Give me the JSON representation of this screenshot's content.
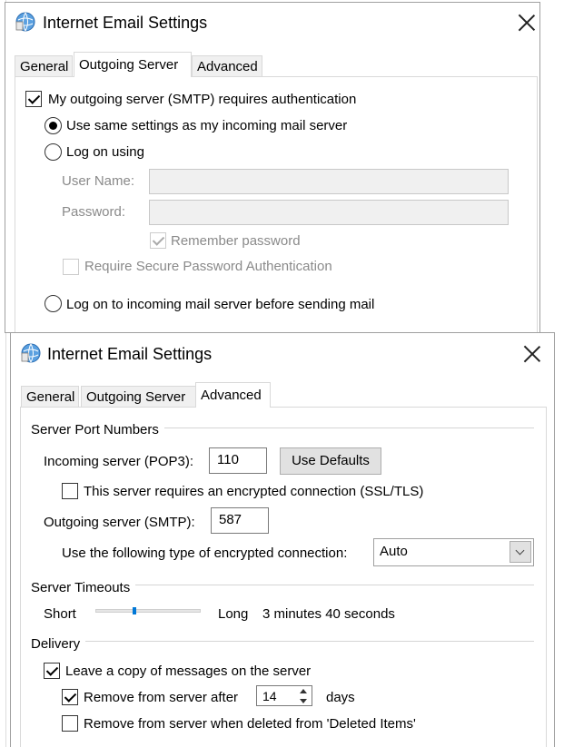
{
  "dialog1": {
    "title": "Internet Email Settings",
    "tabs": [
      {
        "label": "General",
        "active": false
      },
      {
        "label": "Outgoing Server",
        "active": true
      },
      {
        "label": "Advanced",
        "active": false
      }
    ],
    "smtp_auth": {
      "label": "My outgoing server (SMTP) requires authentication",
      "checked": true
    },
    "use_same": {
      "label": "Use same settings as my incoming mail server",
      "selected": true
    },
    "log_on_using": {
      "label": "Log on using",
      "selected": false
    },
    "user_name_label": "User Name:",
    "user_name_value": "",
    "password_label": "Password:",
    "password_value": "",
    "remember_password": {
      "label": "Remember password",
      "checked": true,
      "disabled": true
    },
    "require_spa": {
      "label": "Require Secure Password Authentication",
      "checked": false,
      "disabled": true
    },
    "log_on_incoming": {
      "label": "Log on to incoming mail server before sending mail",
      "selected": false
    }
  },
  "dialog2": {
    "title": "Internet Email Settings",
    "tabs": [
      {
        "label": "General",
        "active": false
      },
      {
        "label": "Outgoing Server",
        "active": false
      },
      {
        "label": "Advanced",
        "active": true
      }
    ],
    "server_port_numbers": "Server Port Numbers",
    "incoming_label": "Incoming server (POP3):",
    "incoming_value": "110",
    "use_defaults": "Use Defaults",
    "ssl_incoming": {
      "label": "This server requires an encrypted connection (SSL/TLS)",
      "checked": false
    },
    "outgoing_label": "Outgoing server (SMTP):",
    "outgoing_value": "587",
    "encryption_label": "Use the following type of encrypted connection:",
    "encryption_value": "Auto",
    "server_timeouts": "Server Timeouts",
    "short_label": "Short",
    "long_label": "Long",
    "timeout_value": "3 minutes 40 seconds",
    "timeout_level_fraction": 0.37,
    "delivery": "Delivery",
    "leave_copy": {
      "label": "Leave a copy of messages on the server",
      "checked": true
    },
    "remove_after": {
      "label": "Remove from server after",
      "checked": true
    },
    "remove_days_value": "14",
    "days_label": "days",
    "remove_deleted": {
      "label": "Remove from server when deleted from 'Deleted Items'",
      "checked": false
    }
  },
  "colors": {
    "accent": "#0078d7",
    "disabled_text": "#8a8a8a",
    "button_face": "#e1e1e1"
  }
}
